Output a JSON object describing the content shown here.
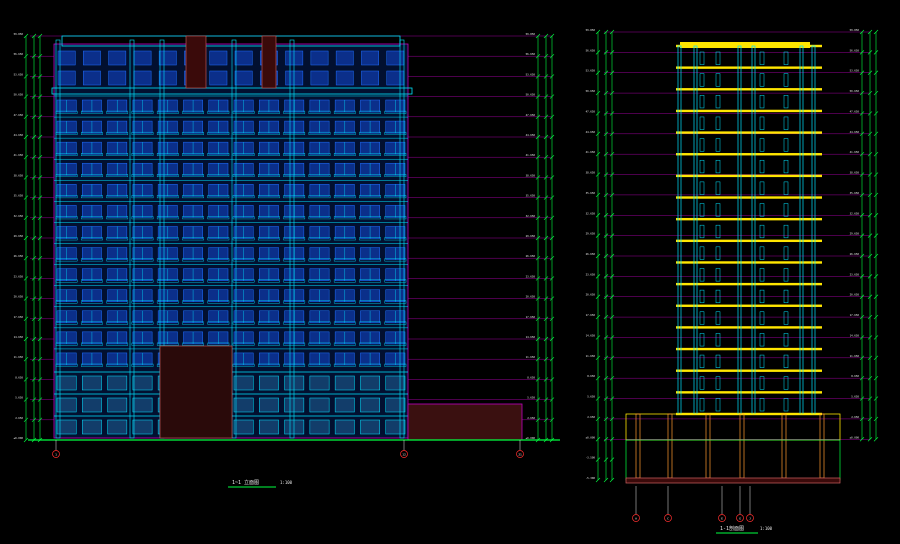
{
  "drawing": {
    "background": "#000000",
    "colors": {
      "cyan": "#00e5ff",
      "blue": "#1f6fff",
      "magenta": "#c000c0",
      "green": "#00ff40",
      "yellow": "#ffe600",
      "white": "#e8e8e8",
      "red": "#ff3030",
      "orange": "#ff9a2e",
      "salmon": "#d06060"
    }
  },
  "elevation": {
    "title": "1~1 立面图",
    "scale": "1:100",
    "floors": 17,
    "bays": 14,
    "axis_labels": [
      "1",
      "12",
      "21"
    ],
    "annex_label": "",
    "level_marks": [
      "59.850",
      "56.650",
      "53.650",
      "50.650",
      "47.650",
      "44.650",
      "41.650",
      "38.650",
      "35.650",
      "32.650",
      "29.650",
      "26.650",
      "23.650",
      "20.650",
      "17.650",
      "14.650",
      "11.650",
      "8.650",
      "5.650",
      "2.650",
      "±0.000"
    ]
  },
  "section": {
    "title": "1-1剖面图",
    "scale": "1:100",
    "floors": 17,
    "axis_labels": [
      "A",
      "C",
      "E",
      "G",
      "J"
    ],
    "level_marks": [
      "59.850",
      "56.650",
      "53.650",
      "50.650",
      "47.650",
      "44.650",
      "41.650",
      "38.650",
      "35.650",
      "32.650",
      "29.650",
      "26.650",
      "23.650",
      "20.650",
      "17.650",
      "14.650",
      "11.650",
      "8.650",
      "5.650",
      "2.650",
      "±0.000",
      "-3.500",
      "-5.300"
    ]
  }
}
